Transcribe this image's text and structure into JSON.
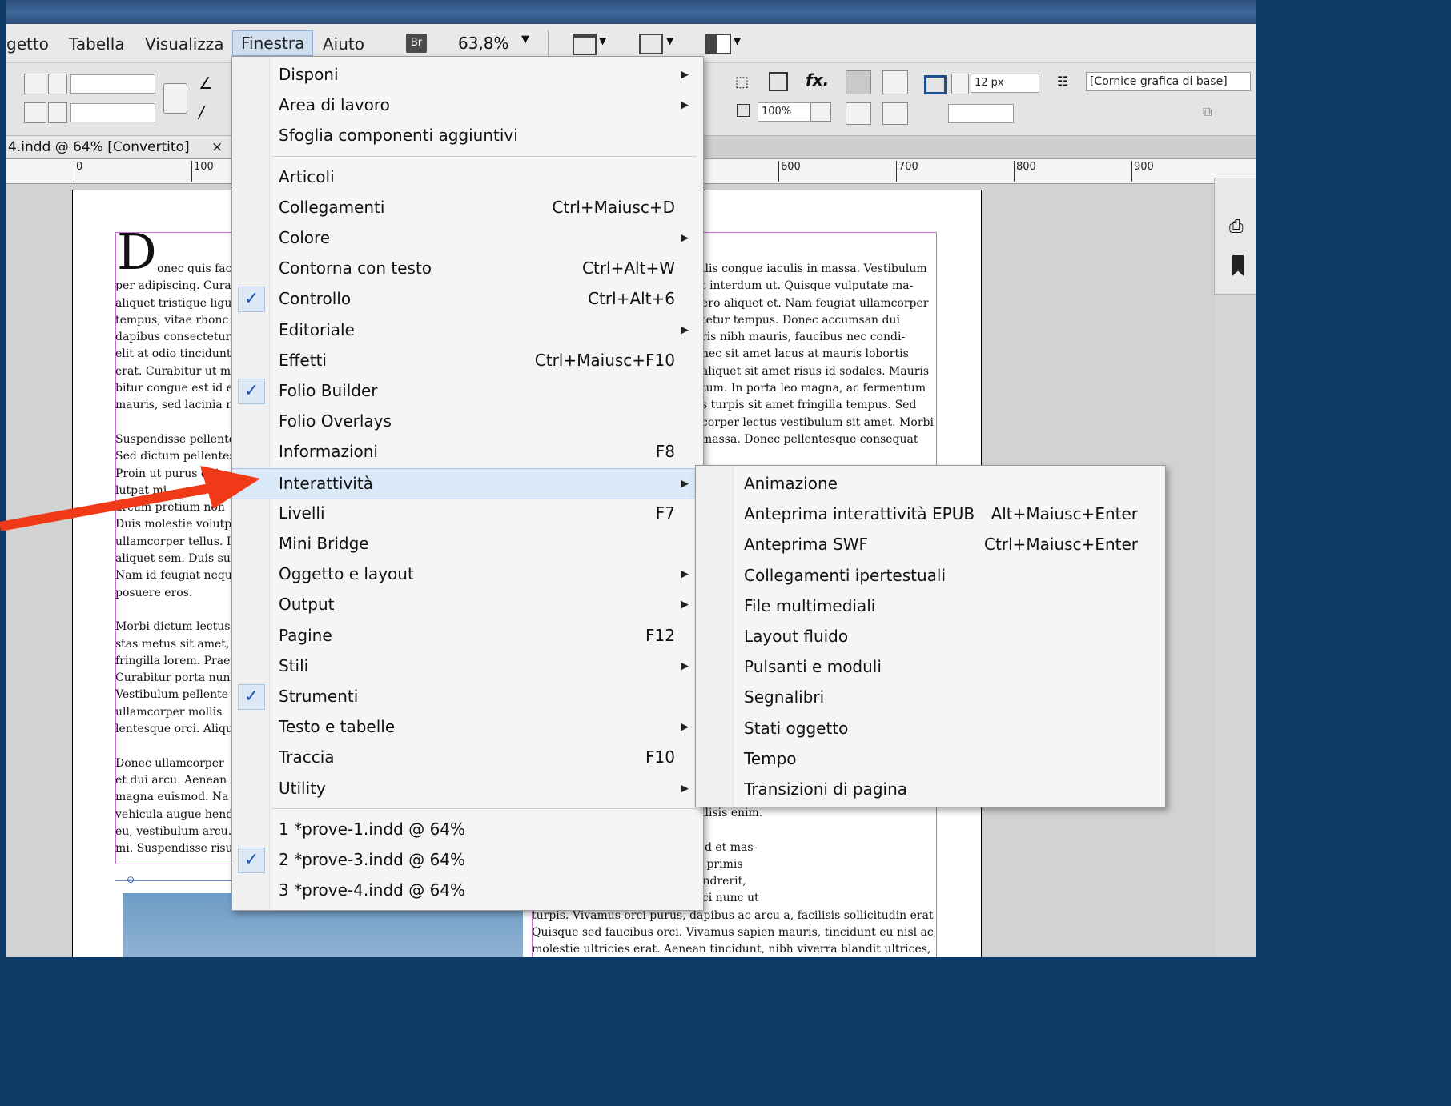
{
  "menubar": {
    "items": [
      "getto",
      "Tabella",
      "Visualizza",
      "Finestra",
      "Aiuto"
    ],
    "bridge_badge": "Br",
    "zoom": "63,8%"
  },
  "control": {
    "stroke_value": "12 px",
    "opacity_value": "100%",
    "object_style": "[Cornice grafica di base]"
  },
  "document": {
    "tab_title": "4.indd @ 64% [Convertito]",
    "tab_close": "×",
    "ruler_labels": [
      "0",
      "100",
      "600",
      "700",
      "800",
      "900"
    ]
  },
  "left_column": [
    "onec quis fac",
    "per adipiscing. Cura",
    "aliquet tristique ligu",
    "tempus, vitae rhonc",
    "dapibus consectetur",
    "elit at odio tincidunt",
    "erat. Curabitur ut m",
    "bitur congue est id e",
    "mauris, sed lacinia n",
    "",
    "Suspendisse pellente",
    "Sed dictum pellentes",
    "Proin ut purus quis",
    "lutpat mi",
    "arcum pretium non",
    "Duis molestie volutp",
    "ullamcorper tellus. I",
    "aliquet sem. Duis su",
    "Nam id feugiat nequ",
    "posuere eros.",
    "",
    "Morbi dictum lectus",
    "stas metus sit amet, f",
    "fringilla lorem. Prae",
    "Curabitur porta nun",
    "Vestibulum pellente",
    "ullamcorper mollis",
    "lentesque orci. Aliqu",
    "",
    "Donec ullamcorper",
    "et dui arcu. Aenean",
    "magna euismod. Na",
    "vehicula augue hend",
    "eu, vestibulum arcu.",
    "mi. Suspendisse risu"
  ],
  "drop_cap": "D",
  "right_column_top": [
    "llis congue iaculis in massa. Vestibulum",
    "t interdum ut. Quisque vulputate ma-",
    "ero aliquet et. Nam feugiat ullamcorper",
    "tetur tempus. Donec accumsan dui",
    "ris nibh mauris, faucibus nec condi-",
    "nec sit amet lacus at mauris lobortis",
    "aliquet sit amet risus id sodales. Mauris",
    "tum. In porta leo magna, ac fermentum",
    "s turpis sit amet fringilla tempus. Sed",
    "corper lectus vestibulum sit amet. Morbi",
    "massa. Donec pellentesque consequat"
  ],
  "right_column_bottom": [
    "ilisis enim.",
    "",
    "drerit aliquet a nec magna. Sed et mas-",
    "uis mi. Vestibulum ante ipsum primis",
    "s posuere cubilia Curae; In hendrerit,",
    "ibh laoreet lacus, ut cursus orci nunc ut",
    "turpis. Vivamus orci purus, dapibus ac arcu a, facilisis sollicitudin erat.",
    "Quisque sed faucibus orci. Vivamus sapien mauris, tincidunt eu nisl ac,",
    "molestie ultricies erat. Aenean tincidunt, nibh viverra blandit ultrices,"
  ],
  "finestra_menu": [
    {
      "label": "Disponi",
      "shortcut": "",
      "submenu": true,
      "checked": false
    },
    {
      "label": "Area di lavoro",
      "shortcut": "",
      "submenu": true,
      "checked": false
    },
    {
      "label": "Sfoglia componenti aggiuntivi",
      "shortcut": "",
      "submenu": false,
      "checked": false
    },
    {
      "label": "Articoli",
      "shortcut": "",
      "submenu": false,
      "checked": false
    },
    {
      "label": "Collegamenti",
      "shortcut": "Ctrl+Maiusc+D",
      "submenu": false,
      "checked": false
    },
    {
      "label": "Colore",
      "shortcut": "",
      "submenu": true,
      "checked": false
    },
    {
      "label": "Contorna con testo",
      "shortcut": "Ctrl+Alt+W",
      "submenu": false,
      "checked": false
    },
    {
      "label": "Controllo",
      "shortcut": "Ctrl+Alt+6",
      "submenu": false,
      "checked": true
    },
    {
      "label": "Editoriale",
      "shortcut": "",
      "submenu": true,
      "checked": false
    },
    {
      "label": "Effetti",
      "shortcut": "Ctrl+Maiusc+F10",
      "submenu": false,
      "checked": false
    },
    {
      "label": "Folio Builder",
      "shortcut": "",
      "submenu": false,
      "checked": true
    },
    {
      "label": "Folio Overlays",
      "shortcut": "",
      "submenu": false,
      "checked": false
    },
    {
      "label": "Informazioni",
      "shortcut": "F8",
      "submenu": false,
      "checked": false
    },
    {
      "label": "Interattività",
      "shortcut": "",
      "submenu": true,
      "checked": false,
      "highlighted": true
    },
    {
      "label": "Livelli",
      "shortcut": "F7",
      "submenu": false,
      "checked": false
    },
    {
      "label": "Mini Bridge",
      "shortcut": "",
      "submenu": false,
      "checked": false
    },
    {
      "label": "Oggetto e layout",
      "shortcut": "",
      "submenu": true,
      "checked": false
    },
    {
      "label": "Output",
      "shortcut": "",
      "submenu": true,
      "checked": false
    },
    {
      "label": "Pagine",
      "shortcut": "F12",
      "submenu": false,
      "checked": false
    },
    {
      "label": "Stili",
      "shortcut": "",
      "submenu": true,
      "checked": false
    },
    {
      "label": "Strumenti",
      "shortcut": "",
      "submenu": false,
      "checked": true
    },
    {
      "label": "Testo e tabelle",
      "shortcut": "",
      "submenu": true,
      "checked": false
    },
    {
      "label": "Traccia",
      "shortcut": "F10",
      "submenu": false,
      "checked": false
    },
    {
      "label": "Utility",
      "shortcut": "",
      "submenu": true,
      "checked": false
    },
    {
      "label": "1 *prove-1.indd @ 64%",
      "shortcut": "",
      "submenu": false,
      "checked": false
    },
    {
      "label": "2 *prove-3.indd @ 64%",
      "shortcut": "",
      "submenu": false,
      "checked": true
    },
    {
      "label": "3 *prove-4.indd @ 64%",
      "shortcut": "",
      "submenu": false,
      "checked": false
    }
  ],
  "interattivita_submenu": [
    {
      "label": "Animazione",
      "shortcut": ""
    },
    {
      "label": "Anteprima interattività EPUB",
      "shortcut": "Alt+Maiusc+Enter"
    },
    {
      "label": "Anteprima SWF",
      "shortcut": "Ctrl+Maiusc+Enter"
    },
    {
      "label": "Collegamenti ipertestuali",
      "shortcut": ""
    },
    {
      "label": "File multimediali",
      "shortcut": ""
    },
    {
      "label": "Layout fluido",
      "shortcut": ""
    },
    {
      "label": "Pulsanti e moduli",
      "shortcut": ""
    },
    {
      "label": "Segnalibri",
      "shortcut": ""
    },
    {
      "label": "Stati oggetto",
      "shortcut": ""
    },
    {
      "label": "Tempo",
      "shortcut": ""
    },
    {
      "label": "Transizioni di pagina",
      "shortcut": ""
    }
  ],
  "colors": {
    "highlight": "#dbe8f7",
    "check": "#1f56b8",
    "annotation_arrow": "#f03a17",
    "frame_edge": "#c96fd1"
  }
}
